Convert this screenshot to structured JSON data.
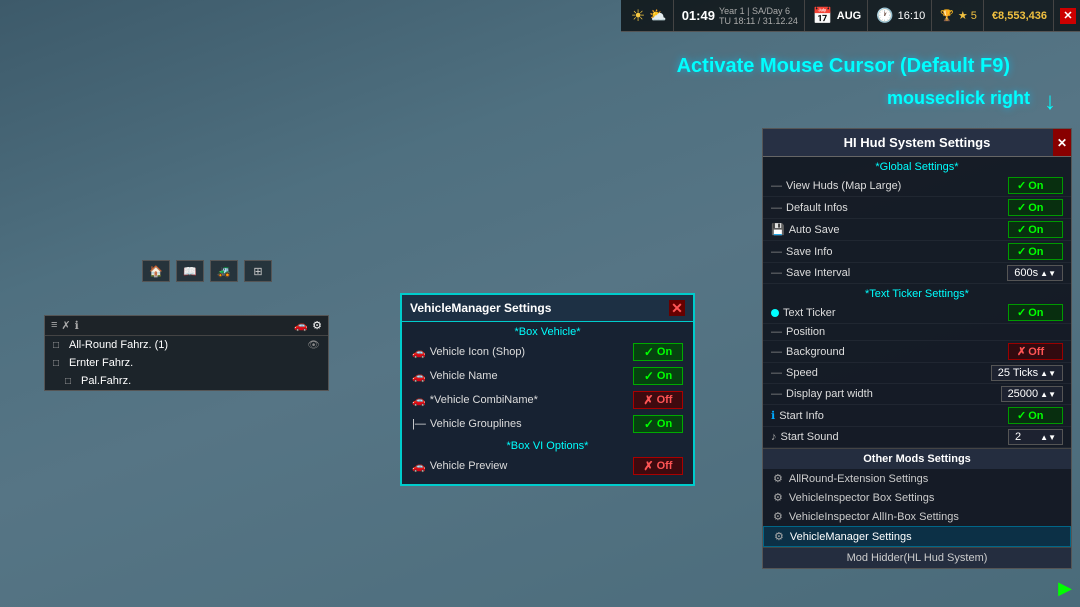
{
  "gameHud": {
    "time": "01:49",
    "yearDay": "Year 1 | SA/Day 6",
    "dayDate": "TU 18:11 / 31.12.24",
    "month": "AUG",
    "clock": "16:10",
    "stars": "★ 5",
    "money": "€8,553,436",
    "closeLabel": "✕"
  },
  "cursorActivation": {
    "activateText": "Activate Mouse Cursor (Default F9)",
    "mouseclickText": "mouseclick right",
    "arrowIcon": "↓"
  },
  "vehicleListPanel": {
    "items": [
      {
        "label": "All-Round Fahrz. (1)",
        "hasEye": true,
        "indent": 0
      },
      {
        "label": "Ernter Fahrz.",
        "hasEye": false,
        "indent": 0
      },
      {
        "label": "Pal.Fahrz.",
        "hasEye": false,
        "indent": 1
      }
    ]
  },
  "vehicleManagerPanel": {
    "title": "VehicleManager Settings",
    "sectionBoxVehicle": "*Box Vehicle*",
    "settings": [
      {
        "label": "Vehicle Icon (Shop)",
        "state": "On",
        "on": true,
        "icon": "car"
      },
      {
        "label": "Vehicle Name",
        "state": "On",
        "on": true,
        "icon": "car"
      },
      {
        "label": "*Vehicle CombiName*",
        "state": "Off",
        "on": false,
        "icon": "car"
      },
      {
        "label": "Vehicle Grouplines",
        "state": "On",
        "on": true,
        "icon": "lines"
      }
    ],
    "sectionBoxVI": "*Box VI Options*",
    "settingsVI": [
      {
        "label": "Vehicle Preview",
        "state": "Off",
        "on": false,
        "icon": "car"
      }
    ]
  },
  "hudSettingsPanel": {
    "title": "HI Hud System Settings",
    "sectionGlobal": "*Global Settings*",
    "globalSettings": [
      {
        "label": "View Huds (Map Large)",
        "state": "On",
        "on": true,
        "type": "toggle",
        "icon": "check"
      },
      {
        "label": "Default Infos",
        "state": "On",
        "on": true,
        "type": "toggle",
        "icon": "dash"
      },
      {
        "label": "Auto Save",
        "state": "On",
        "on": true,
        "type": "toggle",
        "icon": "floppy"
      },
      {
        "label": "Save Info",
        "state": "On",
        "on": true,
        "type": "toggle",
        "icon": "dash"
      },
      {
        "label": "Save Interval",
        "state": "600s",
        "on": true,
        "type": "value",
        "icon": "dash"
      }
    ],
    "sectionTextTicker": "*Text Ticker Settings*",
    "textTickerSettings": [
      {
        "label": "Text Ticker",
        "state": "On",
        "on": true,
        "type": "toggle",
        "icon": "green"
      },
      {
        "label": "Position",
        "state": "",
        "on": null,
        "type": "none",
        "icon": "dash"
      },
      {
        "label": "Background",
        "state": "Off",
        "on": false,
        "type": "toggle",
        "icon": "dash"
      },
      {
        "label": "Speed",
        "state": "25 Ticks",
        "on": true,
        "type": "value",
        "icon": "dash"
      },
      {
        "label": "Display part width",
        "state": "25000",
        "on": true,
        "type": "value",
        "icon": "dash"
      },
      {
        "label": "Start Info",
        "state": "On",
        "on": true,
        "type": "toggle",
        "icon": "info"
      },
      {
        "label": "Start Sound",
        "state": "2",
        "on": true,
        "type": "value",
        "icon": "note"
      }
    ],
    "otherModsHeader": "Other Mods Settings",
    "otherMods": [
      {
        "label": "AllRound-Extension Settings",
        "active": false
      },
      {
        "label": "VehicleInspector Box Settings",
        "active": false
      },
      {
        "label": "VehicleInspector AllIn-Box Settings",
        "active": false
      },
      {
        "label": "VehicleManager Settings",
        "active": true
      }
    ],
    "modHidder": "Mod Hidder(HL Hud System)"
  }
}
